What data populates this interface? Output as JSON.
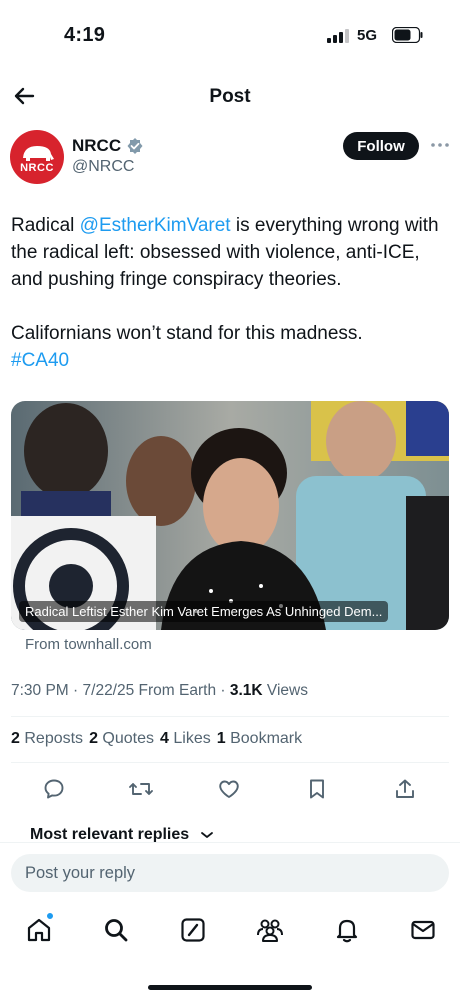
{
  "status": {
    "time": "4:19",
    "network": "5G",
    "signal_bars_active": 3,
    "signal_bars_total": 4
  },
  "header": {
    "title": "Post",
    "back_icon": "arrow-left-icon"
  },
  "author": {
    "name": "NRCC",
    "handle": "@NRCC",
    "avatar_text": "NRCC",
    "verified": true,
    "follow_label": "Follow",
    "more_icon": "more-horizontal-icon"
  },
  "tweet": {
    "text_before_mention": "Radical ",
    "mention": "@EstherKimVaret",
    "text_after_mention": " is everything wrong with the radical left: obsessed with violence, anti-ICE, and pushing fringe conspiracy theories.",
    "text_line2": "Californians won’t stand for this madness.",
    "hashtag": "#CA40"
  },
  "media": {
    "caption": "Radical Leftist Esther Kim Varet Emerges As Unhinged Dem...",
    "source": "From townhall.com"
  },
  "meta": {
    "time": "7:30 PM",
    "date": "7/22/25",
    "from": "From Earth",
    "views_count": "3.1K",
    "views_label": "Views"
  },
  "stats": {
    "reposts_count": "2",
    "reposts_label": "Reposts",
    "quotes_count": "2",
    "quotes_label": "Quotes",
    "likes_count": "4",
    "likes_label": "Likes",
    "bookmarks_count": "1",
    "bookmarks_label": "Bookmark"
  },
  "actions": [
    "reply-icon",
    "repost-icon",
    "like-icon",
    "bookmark-icon",
    "share-icon"
  ],
  "replies": {
    "sort_label": "Most relevant replies"
  },
  "composer": {
    "placeholder": "Post your reply"
  },
  "tabs": [
    "home-icon",
    "search-icon",
    "grok-icon",
    "communities-icon",
    "notifications-icon",
    "messages-icon"
  ],
  "colors": {
    "accent": "#1d9bf0",
    "text": "#0f1419",
    "muted": "#536471",
    "brand_red": "#d7232d"
  }
}
